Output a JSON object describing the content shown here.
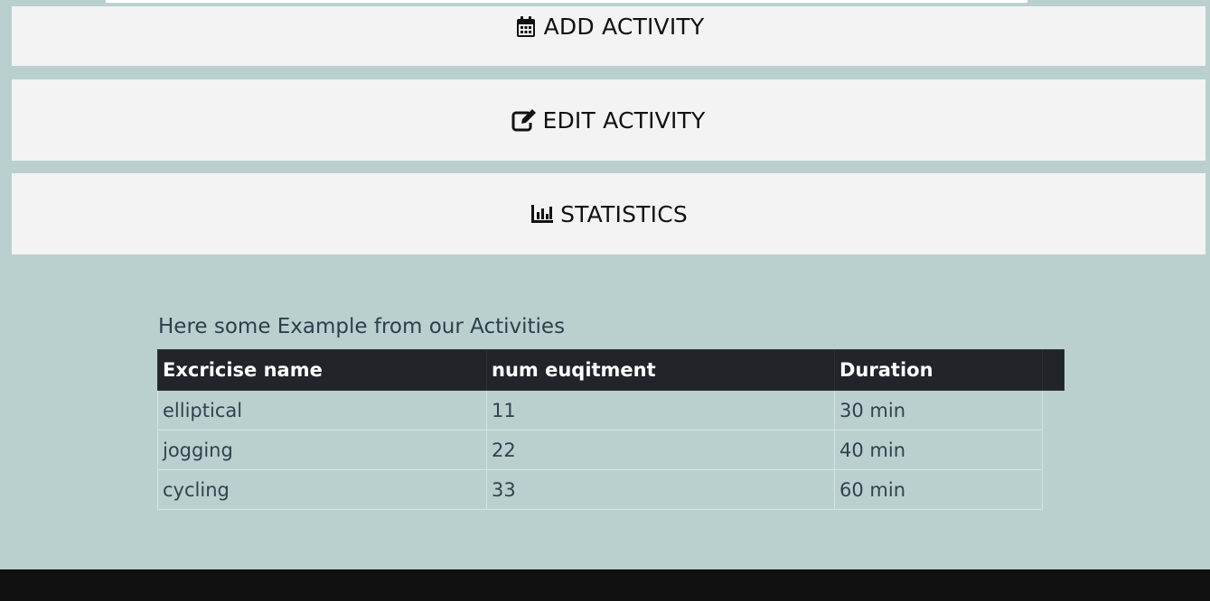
{
  "nav": {
    "add_label": "ADD ACTIVITY",
    "edit_label": "EDIT ACTIVITY",
    "stats_label": "STATISTICS"
  },
  "activities": {
    "title": "Here some Example from our Activities",
    "headers": [
      "Excricise name",
      "num euqitment",
      "Duration"
    ],
    "rows": [
      [
        "elliptical",
        "11",
        "30 min"
      ],
      [
        "jogging",
        "22",
        "40 min"
      ],
      [
        "cycling",
        "33",
        "60 min"
      ]
    ]
  },
  "icons": {
    "add": "calendar-icon",
    "edit": "edit-icon",
    "stats": "bar-chart-icon"
  },
  "colors": {
    "background": "#bad0cf",
    "button": "#f3f3f3",
    "table_header": "#212529",
    "footer": "#111111"
  }
}
